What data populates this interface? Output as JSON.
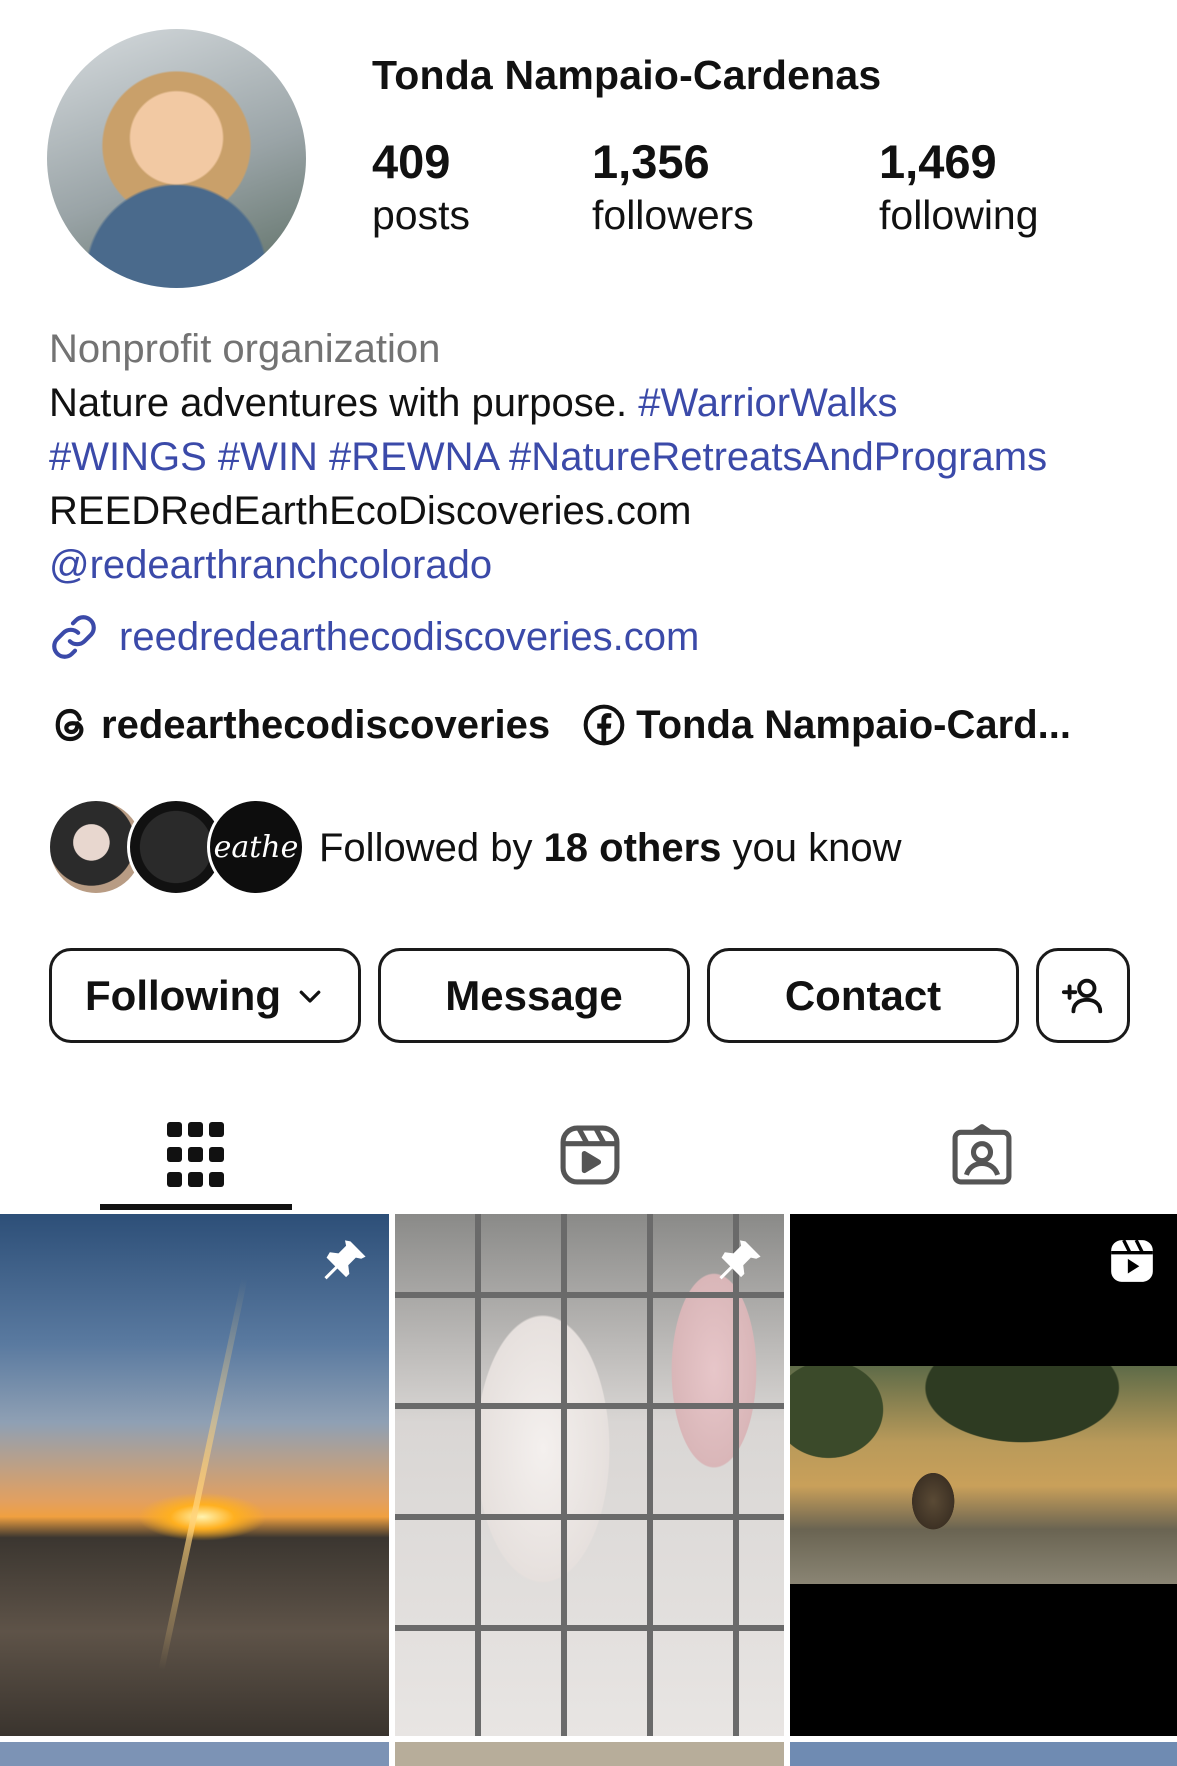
{
  "profile": {
    "name": "Tonda Nampaio-Cardenas",
    "stats": [
      {
        "value": "409",
        "label": "posts"
      },
      {
        "value": "1,356",
        "label": "followers"
      },
      {
        "value": "1,469",
        "label": "following"
      }
    ]
  },
  "bio": {
    "category": "Nonprofit organization",
    "line1_text": "Nature adventures with purpose. ",
    "line1_tag": "#WarriorWalks",
    "line2_tags": "#WINGS #WIN #REWNA #NatureRetreatsAndPrograms",
    "line3_text": "REEDRedEarthEcoDiscoveries.com",
    "line4_mention": "@redearthranchcolorado",
    "link_text": "reedredearthecodiscoveries.com"
  },
  "social": {
    "threads_handle": "redearthecodiscoveries",
    "facebook_name": "Tonda Nampaio-Card..."
  },
  "mutual": {
    "prefix": "Followed by ",
    "count": "18 others",
    "suffix": " you know",
    "avatar3_text": "eathe"
  },
  "buttons": {
    "following": "Following",
    "message": "Message",
    "contact": "Contact"
  },
  "icons": {
    "link": "link-icon",
    "threads": "threads-icon",
    "facebook": "facebook-icon",
    "chevron": "chevron-down-icon",
    "add_user": "add-user-icon",
    "grid": "grid-icon",
    "reels": "reels-icon",
    "tagged": "tagged-icon",
    "pin": "pin-icon",
    "reel_badge": "reel-badge-icon"
  },
  "colors": {
    "link": "#3b4aa9",
    "category": "#737373",
    "text": "#111111"
  }
}
